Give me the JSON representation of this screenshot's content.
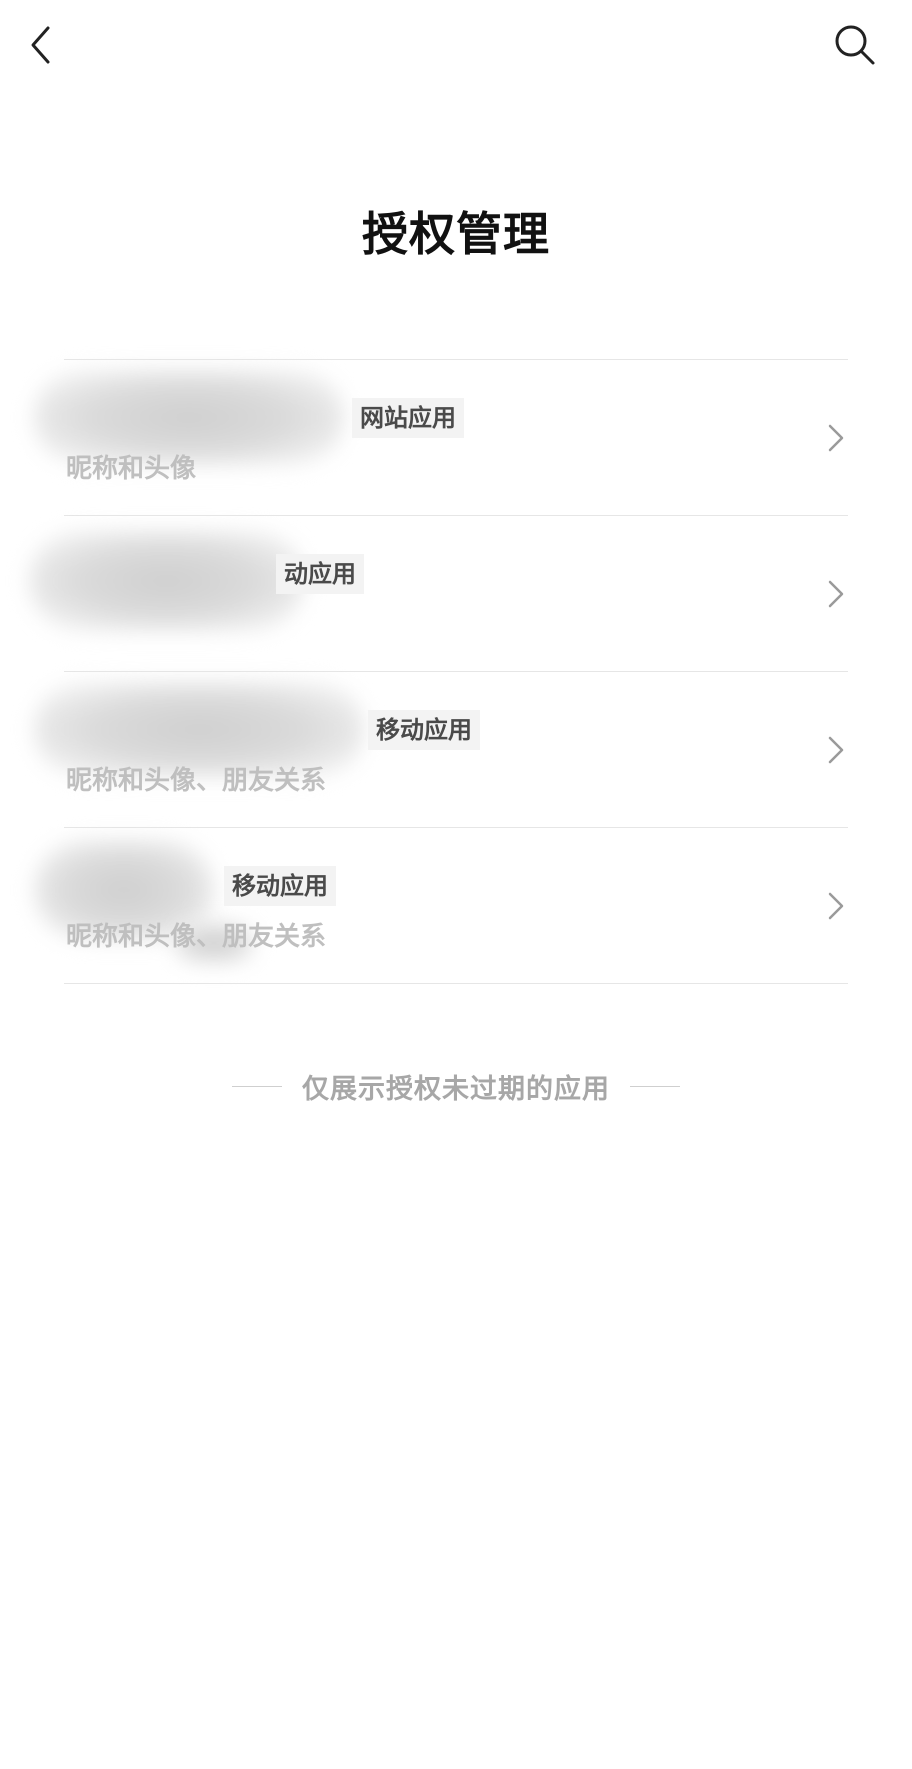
{
  "header": {
    "back_icon": "chevron-left-icon",
    "search_icon": "search-icon"
  },
  "page": {
    "title": "授权管理"
  },
  "apps": [
    {
      "type": "网站应用",
      "scope": "昵称和头像"
    },
    {
      "type": "动应用",
      "scope": ""
    },
    {
      "type": "移动应用",
      "scope": "昵称和头像、朋友关系"
    },
    {
      "type": "移动应用",
      "scope": "昵称和头像、朋友关系"
    }
  ],
  "footer": {
    "note": "仅展示授权未过期的应用"
  },
  "colors": {
    "divider": "#e6e6e6",
    "tag_bg": "#f3f3f3",
    "secondary_text": "#bfbfbf",
    "note_text": "#a7a7a7"
  }
}
